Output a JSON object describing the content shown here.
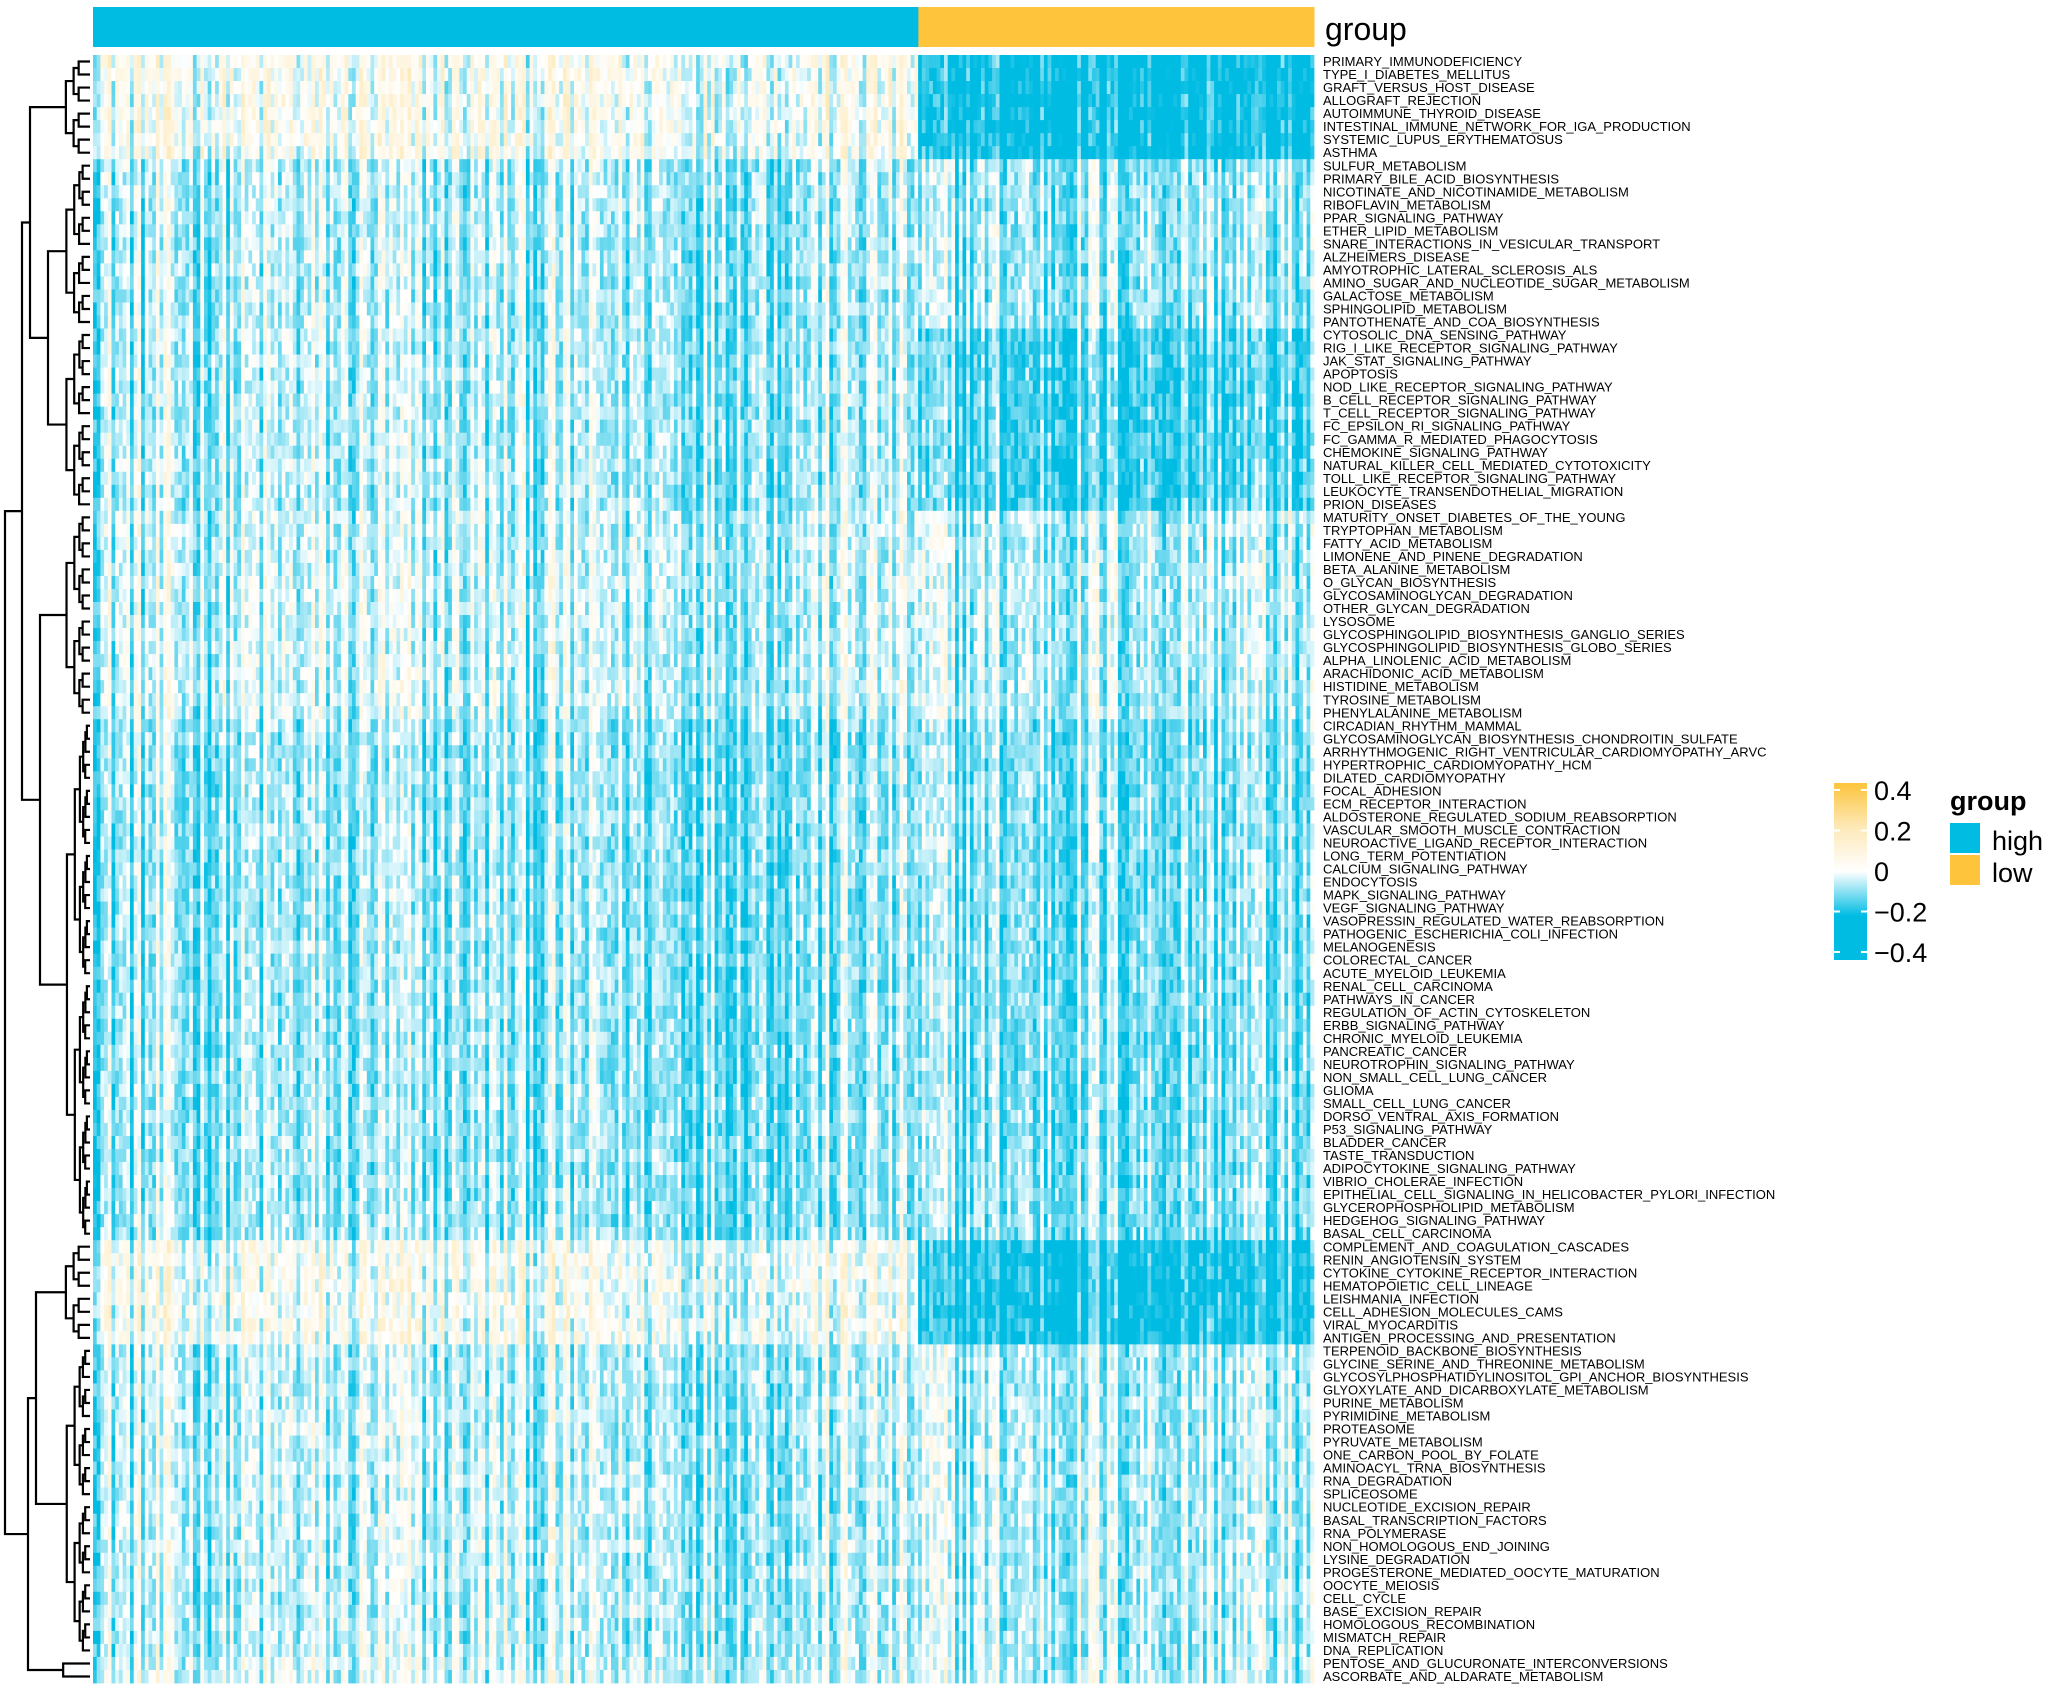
{
  "chart_data": {
    "type": "heatmap",
    "title": "",
    "column_annotation": {
      "title": "group",
      "groups": [
        {
          "name": "high",
          "color": "#00BCE3",
          "fraction_of_columns": 0.676
        },
        {
          "name": "low",
          "color": "#FDC43C",
          "fraction_of_columns": 0.324
        }
      ]
    },
    "color_scale": {
      "min": -0.4,
      "max": 0.4,
      "colors": [
        {
          "value": -0.4,
          "color": "#00BCE3"
        },
        {
          "value": -0.2,
          "color": "#00BCE3"
        },
        {
          "value": 0,
          "color": "#FFFFFF"
        },
        {
          "value": 0.2,
          "color": "#FDE9B8"
        },
        {
          "value": 0.4,
          "color": "#FDC43C"
        }
      ],
      "ticks": [
        0.4,
        0.2,
        0,
        -0.2,
        -0.4
      ],
      "tick_labels": [
        "0.4",
        "0.2",
        "0",
        "−0.2",
        "−0.4"
      ]
    },
    "row_dendrogram": true,
    "rows": [
      "PRIMARY_IMMUNODEFICIENCY",
      "TYPE_I_DIABETES_MELLITUS",
      "GRAFT_VERSUS_HOST_DISEASE",
      "ALLOGRAFT_REJECTION",
      "AUTOIMMUNE_THYROID_DISEASE",
      "INTESTINAL_IMMUNE_NETWORK_FOR_IGA_PRODUCTION",
      "SYSTEMIC_LUPUS_ERYTHEMATOSUS",
      "ASTHMA",
      "SULFUR_METABOLISM",
      "PRIMARY_BILE_ACID_BIOSYNTHESIS",
      "NICOTINATE_AND_NICOTINAMIDE_METABOLISM",
      "RIBOFLAVIN_METABOLISM",
      "PPAR_SIGNALING_PATHWAY",
      "ETHER_LIPID_METABOLISM",
      "SNARE_INTERACTIONS_IN_VESICULAR_TRANSPORT",
      "ALZHEIMERS_DISEASE",
      "AMYOTROPHIC_LATERAL_SCLEROSIS_ALS",
      "AMINO_SUGAR_AND_NUCLEOTIDE_SUGAR_METABOLISM",
      "GALACTOSE_METABOLISM",
      "SPHINGOLIPID_METABOLISM",
      "PANTOTHENATE_AND_COA_BIOSYNTHESIS",
      "CYTOSOLIC_DNA_SENSING_PATHWAY",
      "RIG_I_LIKE_RECEPTOR_SIGNALING_PATHWAY",
      "JAK_STAT_SIGNALING_PATHWAY",
      "APOPTOSIS",
      "NOD_LIKE_RECEPTOR_SIGNALING_PATHWAY",
      "B_CELL_RECEPTOR_SIGNALING_PATHWAY",
      "T_CELL_RECEPTOR_SIGNALING_PATHWAY",
      "FC_EPSILON_RI_SIGNALING_PATHWAY",
      "FC_GAMMA_R_MEDIATED_PHAGOCYTOSIS",
      "CHEMOKINE_SIGNALING_PATHWAY",
      "NATURAL_KILLER_CELL_MEDIATED_CYTOTOXICITY",
      "TOLL_LIKE_RECEPTOR_SIGNALING_PATHWAY",
      "LEUKOCYTE_TRANSENDOTHELIAL_MIGRATION",
      "PRION_DISEASES",
      "MATURITY_ONSET_DIABETES_OF_THE_YOUNG",
      "TRYPTOPHAN_METABOLISM",
      "FATTY_ACID_METABOLISM",
      "LIMONENE_AND_PINENE_DEGRADATION",
      "BETA_ALANINE_METABOLISM",
      "O_GLYCAN_BIOSYNTHESIS",
      "GLYCOSAMINOGLYCAN_DEGRADATION",
      "OTHER_GLYCAN_DEGRADATION",
      "LYSOSOME",
      "GLYCOSPHINGOLIPID_BIOSYNTHESIS_GANGLIO_SERIES",
      "GLYCOSPHINGOLIPID_BIOSYNTHESIS_GLOBO_SERIES",
      "ALPHA_LINOLENIC_ACID_METABOLISM",
      "ARACHIDONIC_ACID_METABOLISM",
      "HISTIDINE_METABOLISM",
      "TYROSINE_METABOLISM",
      "PHENYLALANINE_METABOLISM",
      "CIRCADIAN_RHYTHM_MAMMAL",
      "GLYCOSAMINOGLYCAN_BIOSYNTHESIS_CHONDROITIN_SULFATE",
      "ARRHYTHMOGENIC_RIGHT_VENTRICULAR_CARDIOMYOPATHY_ARVC",
      "HYPERTROPHIC_CARDIOMYOPATHY_HCM",
      "DILATED_CARDIOMYOPATHY",
      "FOCAL_ADHESION",
      "ECM_RECEPTOR_INTERACTION",
      "ALDOSTERONE_REGULATED_SODIUM_REABSORPTION",
      "VASCULAR_SMOOTH_MUSCLE_CONTRACTION",
      "NEUROACTIVE_LIGAND_RECEPTOR_INTERACTION",
      "LONG_TERM_POTENTIATION",
      "CALCIUM_SIGNALING_PATHWAY",
      "ENDOCYTOSIS",
      "MAPK_SIGNALING_PATHWAY",
      "VEGF_SIGNALING_PATHWAY",
      "VASOPRESSIN_REGULATED_WATER_REABSORPTION",
      "PATHOGENIC_ESCHERICHIA_COLI_INFECTION",
      "MELANOGENESIS",
      "COLORECTAL_CANCER",
      "ACUTE_MYELOID_LEUKEMIA",
      "RENAL_CELL_CARCINOMA",
      "PATHWAYS_IN_CANCER",
      "REGULATION_OF_ACTIN_CYTOSKELETON",
      "ERBB_SIGNALING_PATHWAY",
      "CHRONIC_MYELOID_LEUKEMIA",
      "PANCREATIC_CANCER",
      "NEUROTROPHIN_SIGNALING_PATHWAY",
      "NON_SMALL_CELL_LUNG_CANCER",
      "GLIOMA",
      "SMALL_CELL_LUNG_CANCER",
      "DORSO_VENTRAL_AXIS_FORMATION",
      "P53_SIGNALING_PATHWAY",
      "BLADDER_CANCER",
      "TASTE_TRANSDUCTION",
      "ADIPOCYTOKINE_SIGNALING_PATHWAY",
      "VIBRIO_CHOLERAE_INFECTION",
      "EPITHELIAL_CELL_SIGNALING_IN_HELICOBACTER_PYLORI_INFECTION",
      "GLYCEROPHOSPHOLIPID_METABOLISM",
      "HEDGEHOG_SIGNALING_PATHWAY",
      "BASAL_CELL_CARCINOMA",
      "COMPLEMENT_AND_COAGULATION_CASCADES",
      "RENIN_ANGIOTENSIN_SYSTEM",
      "CYTOKINE_CYTOKINE_RECEPTOR_INTERACTION",
      "HEMATOPOIETIC_CELL_LINEAGE",
      "LEISHMANIA_INFECTION",
      "CELL_ADHESION_MOLECULES_CAMS",
      "VIRAL_MYOCARDITIS",
      "ANTIGEN_PROCESSING_AND_PRESENTATION",
      "TERPENOID_BACKBONE_BIOSYNTHESIS",
      "GLYCINE_SERINE_AND_THREONINE_METABOLISM",
      "GLYCOSYLPHOSPHATIDYLINOSITOL_GPI_ANCHOR_BIOSYNTHESIS",
      "GLYOXYLATE_AND_DICARBOXYLATE_METABOLISM",
      "PURINE_METABOLISM",
      "PYRIMIDINE_METABOLISM",
      "PROTEASOME",
      "PYRUVATE_METABOLISM",
      "ONE_CARBON_POOL_BY_FOLATE",
      "AMINOACYL_TRNA_BIOSYNTHESIS",
      "RNA_DEGRADATION",
      "SPLICEOSOME",
      "NUCLEOTIDE_EXCISION_REPAIR",
      "BASAL_TRANSCRIPTION_FACTORS",
      "RNA_POLYMERASE",
      "NON_HOMOLOGOUS_END_JOINING",
      "LYSINE_DEGRADATION",
      "PROGESTERONE_MEDIATED_OOCYTE_MATURATION",
      "OOCYTE_MEIOSIS",
      "CELL_CYCLE",
      "BASE_EXCISION_REPAIR",
      "HOMOLOGOUS_RECOMBINATION",
      "MISMATCH_REPAIR",
      "DNA_REPLICATION",
      "PENTOSE_AND_GLUCURONATE_INTERCONVERSIONS",
      "ASCORBATE_AND_ALDARATE_METABOLISM"
    ],
    "row_clusters_approx_mean": [
      {
        "from": "PRIMARY_IMMUNODEFICIENCY",
        "to": "ASTHMA",
        "high_mean": 0.02,
        "low_mean": -0.22
      },
      {
        "from": "SULFUR_METABOLISM",
        "to": "PANTOTHENATE_AND_COA_BIOSYNTHESIS",
        "high_mean": -0.06,
        "low_mean": -0.07
      },
      {
        "from": "CYTOSOLIC_DNA_SENSING_PATHWAY",
        "to": "PRION_DISEASES",
        "high_mean": -0.06,
        "low_mean": -0.14
      },
      {
        "from": "MATURITY_ONSET_DIABETES_OF_THE_YOUNG",
        "to": "PHENYLALANINE_METABOLISM",
        "high_mean": -0.04,
        "low_mean": -0.05
      },
      {
        "from": "CIRCADIAN_RHYTHM_MAMMAL",
        "to": "BASAL_CELL_CARCINOMA",
        "high_mean": -0.08,
        "low_mean": -0.09
      },
      {
        "from": "COMPLEMENT_AND_COAGULATION_CASCADES",
        "to": "ANTIGEN_PROCESSING_AND_PRESENTATION",
        "high_mean": 0.01,
        "low_mean": -0.2
      },
      {
        "from": "TERPENOID_BACKBONE_BIOSYNTHESIS",
        "to": "DNA_REPLICATION",
        "high_mean": -0.05,
        "low_mean": -0.05
      },
      {
        "from": "PENTOSE_AND_GLUCURONATE_INTERCONVERSIONS",
        "to": "ASCORBATE_AND_ALDARATE_METABOLISM",
        "high_mean": -0.03,
        "low_mean": -0.04
      }
    ]
  }
}
